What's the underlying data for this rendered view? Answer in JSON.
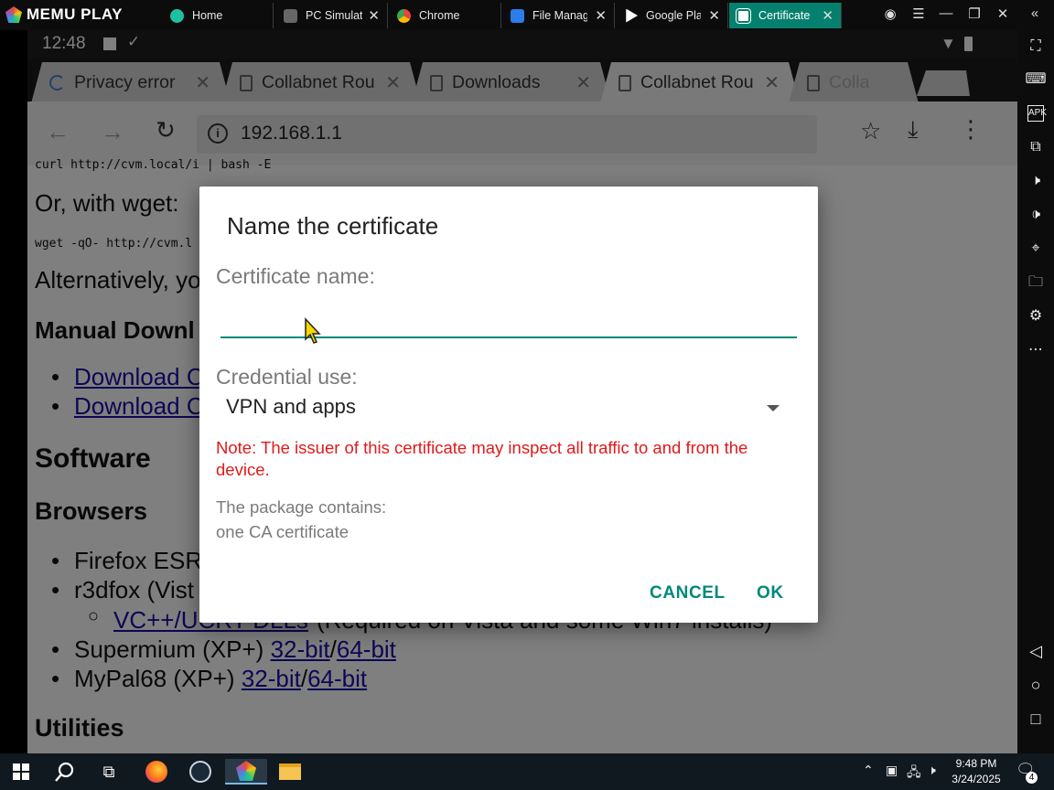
{
  "emulator": {
    "brand": "MEMU PLAY",
    "tabs": [
      {
        "label": "Home",
        "icon": "home-app-icon",
        "color": "#1fbfa0"
      },
      {
        "label": "PC Simulator",
        "icon": "pc-simulator-icon",
        "color": "#666666"
      },
      {
        "label": "Chrome",
        "icon": "chrome-icon",
        "color": "#e8453c"
      },
      {
        "label": "File Manager",
        "icon": "folder-icon",
        "color": "#2b7de9"
      },
      {
        "label": "Google Play",
        "icon": "play-store-icon",
        "color": "#1aa260"
      },
      {
        "label": "Certificate",
        "icon": "android-icon",
        "color": "#05806e"
      }
    ],
    "right_toolbar": [
      "fullscreen-icon",
      "keyboard-icon",
      "apk-icon",
      "multi-window-icon",
      "volume-up-icon",
      "volume-down-icon",
      "location-icon",
      "shared-folder-icon",
      "settings-icon",
      "more-icon"
    ],
    "nav": [
      "back-icon",
      "home-icon",
      "recents-icon"
    ]
  },
  "android": {
    "time": "12:48"
  },
  "chrome": {
    "tabs": [
      {
        "label": "Privacy error"
      },
      {
        "label": "Collabnet Rou"
      },
      {
        "label": "Downloads"
      },
      {
        "label": "Collabnet Rou"
      },
      {
        "label": "Colla"
      }
    ],
    "url": "192.168.1.1"
  },
  "page": {
    "code1": "curl http://cvm.local/i | bash -E",
    "wget_heading": "Or, with wget:",
    "code2": "wget -qO- http://cvm.l",
    "alt_text": "Alternatively, yo",
    "manual_heading": "Manual Downl",
    "download_links": [
      "Download C",
      "Download C"
    ],
    "software_heading": "Software",
    "browsers_heading": "Browsers",
    "browser_items": [
      "Firefox ESR",
      "r3dfox (Vist"
    ],
    "vc_link": "VC++/UCRT DLLs",
    "vc_note": "(Required on Vista and some Win7 installs)",
    "supermium": {
      "name": "Supermium (XP+)",
      "link32": "32-bit",
      "sep": "/",
      "link64": "64-bit"
    },
    "mypal": {
      "name": "MyPal68 (XP+)",
      "link32": "32-bit",
      "sep": "/",
      "link64": "64-bit"
    },
    "utilities_heading": "Utilities"
  },
  "dialog": {
    "title": "Name the certificate",
    "name_label": "Certificate name:",
    "name_value": "",
    "use_label": "Credential use:",
    "use_value": "VPN and apps",
    "note": "Note: The issuer of this certificate may inspect all traffic to and from the device.",
    "package_line1": "The package contains:",
    "package_line2": "one CA certificate",
    "cancel": "CANCEL",
    "ok": "OK",
    "accent": "#00897b",
    "warning_color": "#e01a1a"
  },
  "taskbar": {
    "time": "9:48 PM",
    "date": "3/24/2025",
    "notifications": "4",
    "apps": [
      "start-icon",
      "search-icon",
      "task-view-icon",
      "firefox-icon",
      "steam-icon",
      "memu-icon",
      "file-explorer-icon"
    ]
  }
}
